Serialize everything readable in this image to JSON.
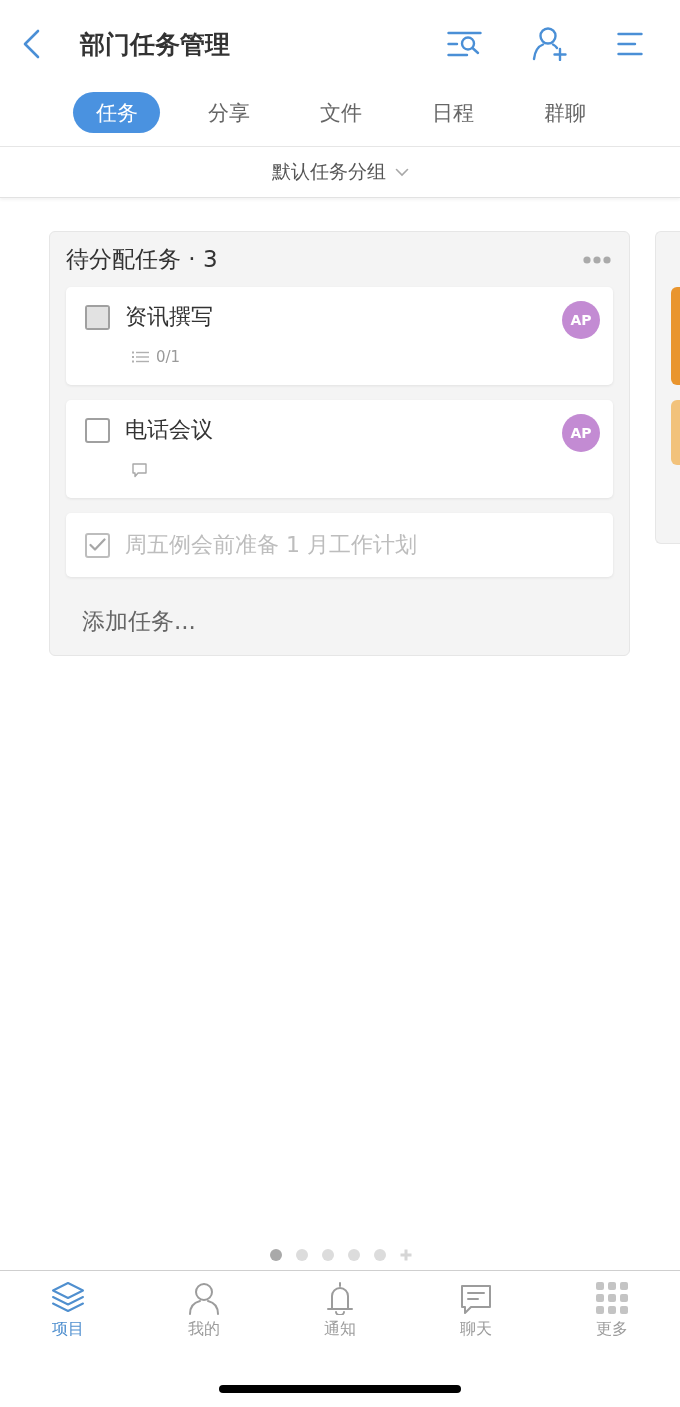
{
  "header": {
    "title": "部门任务管理"
  },
  "tabs": [
    {
      "label": "任务",
      "selected": true
    },
    {
      "label": "分享",
      "selected": false
    },
    {
      "label": "文件",
      "selected": false
    },
    {
      "label": "日程",
      "selected": false
    },
    {
      "label": "群聊",
      "selected": false
    }
  ],
  "group_selector": {
    "label": "默认任务分组"
  },
  "board": {
    "title": "待分配任务 · 3",
    "tasks": [
      {
        "title": "资讯撰写",
        "checked": false,
        "highlighted": true,
        "assignee": "AP",
        "meta": {
          "kind": "subtasks",
          "text": "0/1"
        }
      },
      {
        "title": "电话会议",
        "checked": false,
        "highlighted": false,
        "assignee": "AP",
        "meta": {
          "kind": "comments"
        }
      },
      {
        "title": "周五例会前准备 1 月工作计划",
        "checked": true,
        "highlighted": false
      }
    ],
    "add_label": "添加任务..."
  },
  "next_column": {
    "cards": [
      {
        "color": "#e9952e"
      },
      {
        "color": "#f2c27b"
      }
    ]
  },
  "pager": {
    "pages": [
      {
        "selected": true
      },
      {
        "selected": false
      },
      {
        "selected": false
      },
      {
        "selected": false
      },
      {
        "selected": false
      }
    ]
  },
  "nav": [
    {
      "label": "项目",
      "selected": true
    },
    {
      "label": "我的",
      "selected": false
    },
    {
      "label": "通知",
      "selected": false
    },
    {
      "label": "聊天",
      "selected": false
    },
    {
      "label": "更多",
      "selected": false
    }
  ]
}
